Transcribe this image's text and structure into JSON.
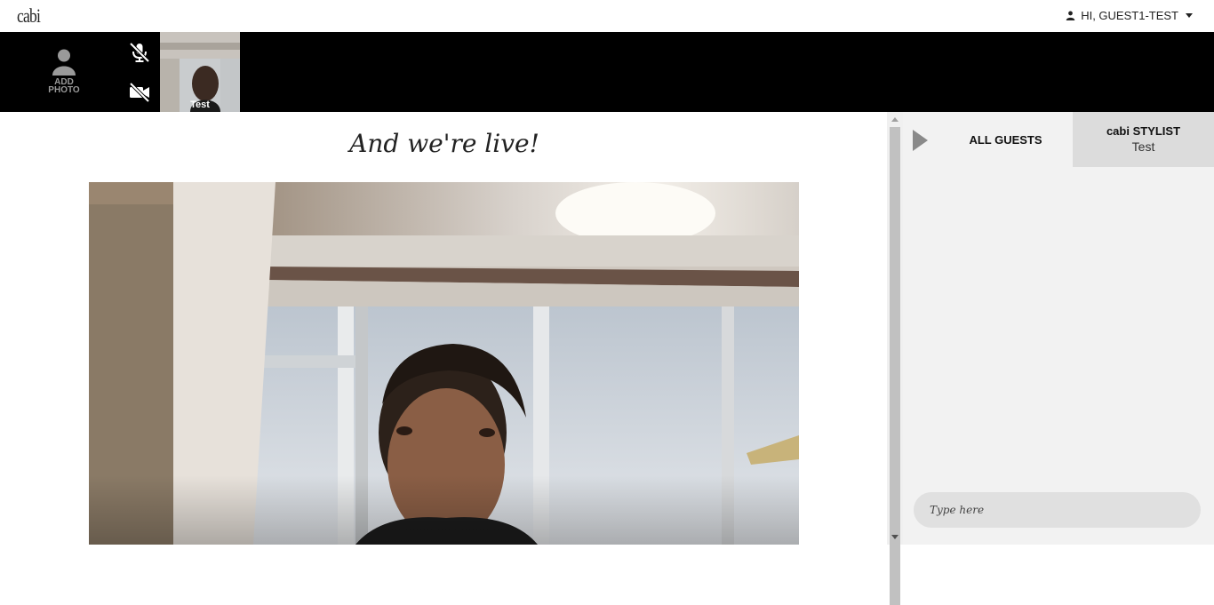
{
  "header": {
    "logo": "cabi",
    "user_greeting": "HI, GUEST1-TEST"
  },
  "video_strip": {
    "add_photo_label_1": "ADD",
    "add_photo_label_2": "PHOTO",
    "mic_state": "muted",
    "camera_state": "off",
    "thumbnail_name": "Test"
  },
  "main": {
    "headline": "And we're live!"
  },
  "chat": {
    "tab_all_guests": "ALL GUESTS",
    "tab_stylist_title": "cabi STYLIST",
    "tab_stylist_name": "Test",
    "input_placeholder": "Type here"
  },
  "colors": {
    "strip_bg": "#000000",
    "chat_bg": "#f2f2f2",
    "active_tab_bg": "#dcdcdc"
  }
}
